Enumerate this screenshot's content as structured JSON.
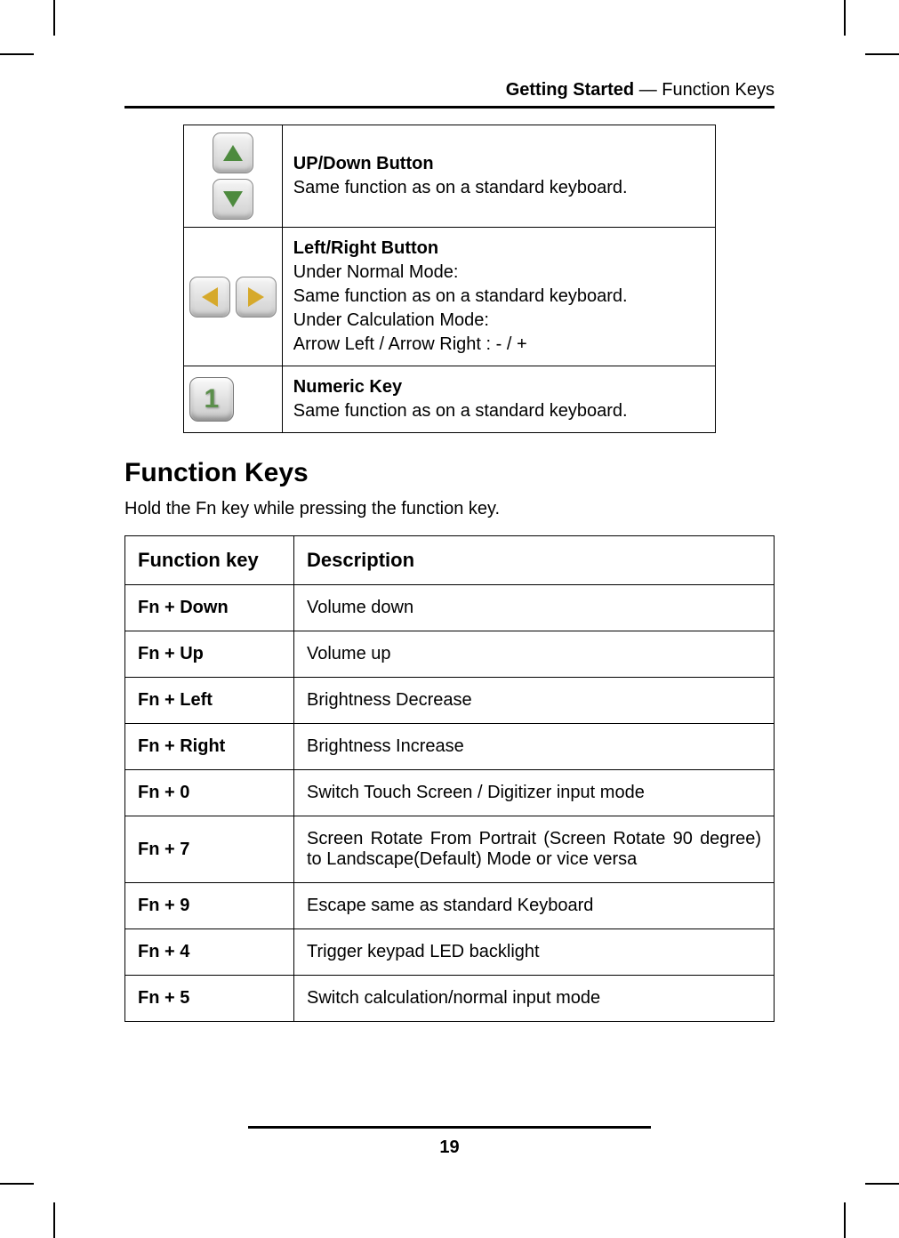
{
  "header": {
    "section": "Getting Started",
    "separator": " — ",
    "topic": "Function Keys"
  },
  "button_table": {
    "rows": [
      {
        "icon": "up-down",
        "title": "UP/Down Button",
        "lines": [
          "Same function as on a standard keyboard."
        ]
      },
      {
        "icon": "left-right",
        "title": "Left/Right Button",
        "lines": [
          "Under Normal Mode:",
          "Same function as on a standard keyboard.",
          "Under  Calculation Mode:",
          "Arrow Left / Arrow Right : - / +"
        ]
      },
      {
        "icon": "numeric",
        "title": "Numeric Key",
        "lines": [
          "Same function as on a standard keyboard."
        ]
      }
    ]
  },
  "section_heading": "Function Keys",
  "section_lead": "Hold the Fn key while pressing the function key.",
  "fn_table": {
    "headers": {
      "key": "Function key",
      "desc": "Description"
    },
    "rows": [
      {
        "key": "Fn + Down",
        "desc": "Volume down"
      },
      {
        "key": "Fn + Up",
        "desc": "Volume up"
      },
      {
        "key": "Fn + Left",
        "desc": "Brightness Decrease"
      },
      {
        "key": "Fn + Right",
        "desc": "Brightness Increase"
      },
      {
        "key": "Fn + 0",
        "desc": "Switch Touch Screen / Digitizer input mode"
      },
      {
        "key": "Fn + 7",
        "desc": "Screen Rotate From Portrait (Screen Rotate 90 degree)  to Landscape(Default) Mode  or vice versa",
        "justify": true
      },
      {
        "key": "Fn + 9",
        "desc": "Escape same as standard Keyboard"
      },
      {
        "key": "Fn + 4",
        "desc": "Trigger keypad LED backlight"
      },
      {
        "key": "Fn + 5",
        "desc": "Switch calculation/normal input mode"
      }
    ]
  },
  "page_number": "19",
  "numeric_key_digit": "1"
}
